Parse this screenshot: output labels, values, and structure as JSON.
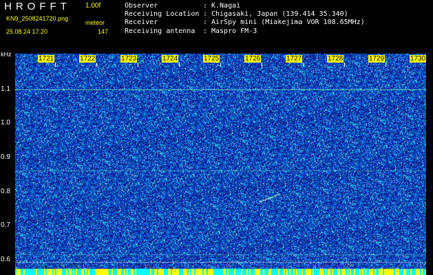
{
  "header": {
    "app_title": "HROFFT",
    "version": "1.00f",
    "file_name": "KN9_2508241720.png",
    "mode": "meteor",
    "datetime": "25.08.24 17:20",
    "count": "147"
  },
  "info": [
    {
      "label": "Observer",
      "sep": ":",
      "value": "K.Nagai"
    },
    {
      "label": "Receiving Location",
      "sep": ":",
      "value": "Chigasaki, Japan (139.414 35.340)"
    },
    {
      "label": "Receiver",
      "sep": ":",
      "value": "AirSpy mini (Miakejima VOR 108.65MHz)"
    },
    {
      "label": "Receiving antenna",
      "sep": ":",
      "value": "Maspro FM-3"
    }
  ],
  "axis": {
    "y_unit": "kHz",
    "y_ticks": [
      "1.1",
      "1.0",
      "0.9",
      "0.8",
      "0.7",
      "0.6"
    ],
    "x_ticks": [
      "1721",
      "1722",
      "1723",
      "1724",
      "1725",
      "1726",
      "1727",
      "1728",
      "1729",
      "1730"
    ]
  },
  "colors": {
    "background": "#000000",
    "spectrogram_base": "#0a1e8c",
    "noise_high": "#00c8ff",
    "label_yellow": "#ffff00",
    "text_white": "#ffffff"
  }
}
